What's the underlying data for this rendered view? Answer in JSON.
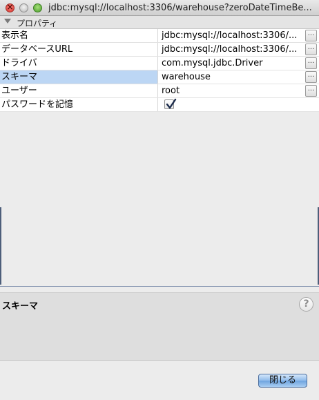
{
  "window": {
    "title": "jdbc:mysql://localhost:3306/warehouse?zeroDateTimeBe..."
  },
  "category": {
    "label": "プロパティ"
  },
  "properties": [
    {
      "name": "表示名",
      "value": "jdbc:mysql://localhost:3306/...",
      "has_editor_button": true
    },
    {
      "name": "データベースURL",
      "value": "jdbc:mysql://localhost:3306/...",
      "has_editor_button": true
    },
    {
      "name": "ドライバ",
      "value": "com.mysql.jdbc.Driver",
      "has_editor_button": true
    },
    {
      "name": "スキーマ",
      "value": "warehouse",
      "has_editor_button": true,
      "selected": true
    },
    {
      "name": "ユーザー",
      "value": "root",
      "has_editor_button": true
    },
    {
      "name": "パスワードを記憶",
      "checked": true
    }
  ],
  "editor_button_label": "...",
  "description": {
    "title": "スキーマ",
    "help_icon_glyph": "?"
  },
  "footer": {
    "close_label": "閉じる"
  },
  "colors": {
    "selection": "#bcd6f4",
    "close_button": "#8fbbea"
  }
}
